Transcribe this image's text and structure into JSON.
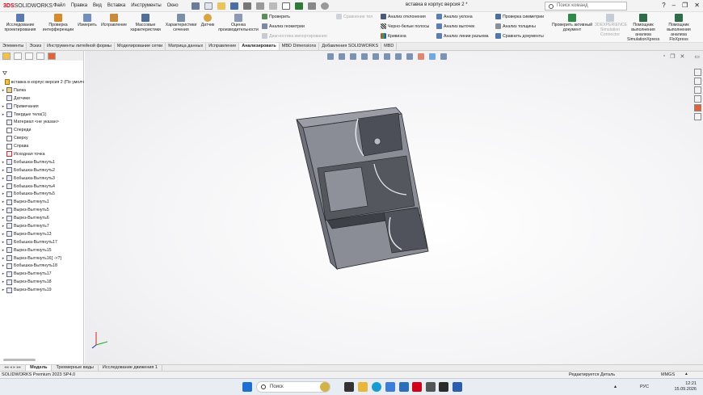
{
  "app": {
    "logo_prefix": "3DS",
    "logo_name": "SOLIDWORKS",
    "doc_title": "вставка в корпус версия 2 *"
  },
  "menu": [
    "Файл",
    "Правка",
    "Вид",
    "Вставка",
    "Инструменты",
    "Окно"
  ],
  "search": {
    "placeholder": "Поиск команд"
  },
  "ribbon": {
    "big": [
      {
        "label": "Исследование проектирования"
      },
      {
        "label": "Проверка интерференции"
      },
      {
        "label": "Измерить"
      },
      {
        "label": "Исправление"
      },
      {
        "label": "Массовые характеристики"
      },
      {
        "label": "Характеристики сечения"
      },
      {
        "label": "Датчик"
      },
      {
        "label": "Оценка производительности"
      }
    ],
    "col1": [
      "Проверить",
      "Анализ геометрии",
      "Диагностика импортирования"
    ],
    "compare_tool": "Сравнение тел",
    "col2": [
      "Анализ отклонения",
      "Черно-белые полосы",
      "Кривизна"
    ],
    "col3": [
      "Анализ уклона",
      "Анализ выточек",
      "Анализ линии разъема"
    ],
    "col4": [
      "Проверка симметрии",
      "Анализ толщины",
      "Сравнить документы"
    ],
    "big_right": [
      {
        "label": "Проверить активный документ"
      },
      {
        "label": "3DEXPERIENCE Simulation Connector"
      },
      {
        "label": "Помощник выполнения анализа SimulationXpress"
      },
      {
        "label": "Помощник выполнения анализа FloXpress"
      }
    ]
  },
  "tabs": [
    "Элементы",
    "Эскиз",
    "Инструменты литейной формы",
    "Моделирование сетки",
    "Матрица данных",
    "Исправление",
    "Анализировать",
    "MBD Dimensions",
    "Добавления SOLIDWORKS",
    "MBD"
  ],
  "active_tab": "Анализировать",
  "tree": [
    {
      "label": "вставка в корпус версия 2 (По умолч",
      "expand": ""
    },
    {
      "label": "Папка",
      "expand": "▸"
    },
    {
      "label": "Датчики",
      "expand": ""
    },
    {
      "label": "Примечания",
      "expand": "▸"
    },
    {
      "label": "Твердые тела(1)",
      "expand": "▸"
    },
    {
      "label": "Материал <не указан>",
      "expand": ""
    },
    {
      "label": "Спереди",
      "expand": ""
    },
    {
      "label": "Сверху",
      "expand": ""
    },
    {
      "label": "Справа",
      "expand": ""
    },
    {
      "label": "Исходная точка",
      "expand": ""
    },
    {
      "label": "Бобышка-Вытянуть1",
      "expand": "▸"
    },
    {
      "label": "Бобышка-Вытянуть2",
      "expand": "▸"
    },
    {
      "label": "Бобышка-Вытянуть3",
      "expand": "▸"
    },
    {
      "label": "Бобышка-Вытянуть4",
      "expand": "▸"
    },
    {
      "label": "Бобышка-Вытянуть5",
      "expand": "▸"
    },
    {
      "label": "Вырез-Вытянуть1",
      "expand": "▸"
    },
    {
      "label": "Вырез-Вытянуть5",
      "expand": "▸"
    },
    {
      "label": "Вырез-Вытянуть6",
      "expand": "▸"
    },
    {
      "label": "Вырез-Вытянуть7",
      "expand": "▸"
    },
    {
      "label": "Вырез-Вытянуть13",
      "expand": "▸"
    },
    {
      "label": "Бобышка-Вытянуть17",
      "expand": "▸"
    },
    {
      "label": "Вырез-Вытянуть15",
      "expand": "▸"
    },
    {
      "label": "Вырез-Вытянуть16[ ->?]",
      "expand": "▸"
    },
    {
      "label": "Бобышка-Вытянуть18",
      "expand": "▸"
    },
    {
      "label": "Вырез-Вытянуть17",
      "expand": "▸"
    },
    {
      "label": "Вырез-Вытянуть18",
      "expand": "▸"
    },
    {
      "label": "Вырез-Вытянуть19",
      "expand": "▸"
    }
  ],
  "bottom_tabs": [
    "Модель",
    "Трехмерные виды",
    "Исследование движения 1"
  ],
  "active_bottom": "Модель",
  "status": {
    "left": "SOLIDWORKS Premium 2023 SP4.0",
    "editing": "Редактируется Деталь",
    "units": "MMGS"
  },
  "taskbar": {
    "search": "Поиск",
    "lang": "РУС",
    "time": "12:21",
    "date": "15.09.2026"
  },
  "colors": {
    "accent_red": "#d0021b",
    "model_face": "#8a8c96",
    "model_dark": "#4c4e58"
  }
}
